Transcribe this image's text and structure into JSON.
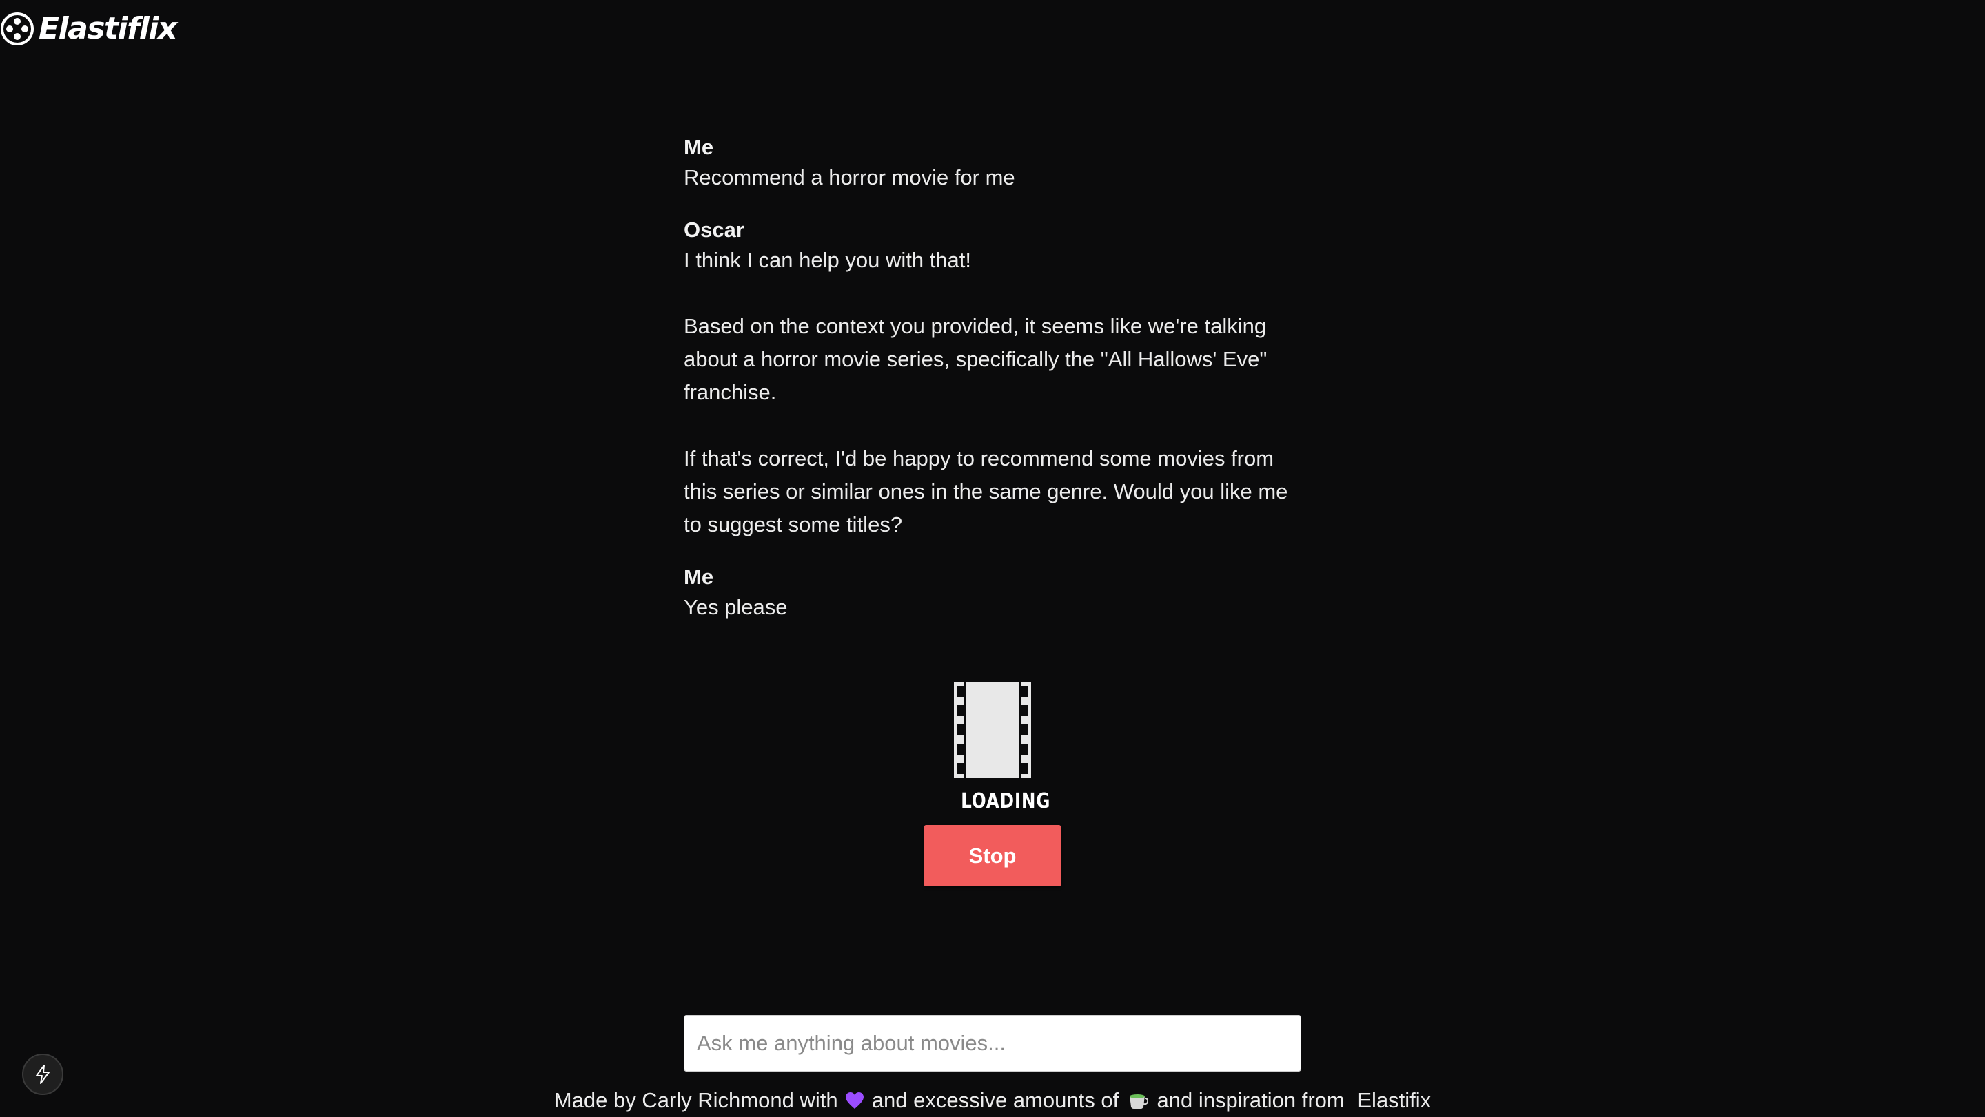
{
  "header": {
    "brand": "Elastiflix",
    "logo_icon": "film-reel-icon"
  },
  "conversation": [
    {
      "sender": "Me",
      "paragraphs": [
        "Recommend a horror movie for me"
      ]
    },
    {
      "sender": "Oscar",
      "paragraphs": [
        "I think I can help you with that!",
        "Based on the context you provided, it seems like we're talking about a horror movie series, specifically the \"All Hallows' Eve\" franchise.",
        "If that's correct, I'd be happy to recommend some movies from this series or similar ones in the same genre. Would you like me to suggest some titles?"
      ]
    },
    {
      "sender": "Me",
      "paragraphs": [
        "Yes please"
      ]
    }
  ],
  "loading": {
    "label": "LOADING",
    "icon": "film-strip-icon"
  },
  "actions": {
    "stop_label": "Stop"
  },
  "input": {
    "placeholder": "Ask me anything about movies...",
    "value": ""
  },
  "footer": {
    "part1": "Made by Carly Richmond with",
    "part2": "and excessive amounts of",
    "part3": "and inspiration from",
    "link": "Elastifix",
    "heart_icon": "purple-heart-icon",
    "tea_icon": "tea-cup-icon"
  },
  "badge": {
    "icon": "lightning-bolt-icon"
  },
  "colors": {
    "background": "#0b0b0c",
    "stop_button": "#f25c5c",
    "text": "#ececec"
  }
}
